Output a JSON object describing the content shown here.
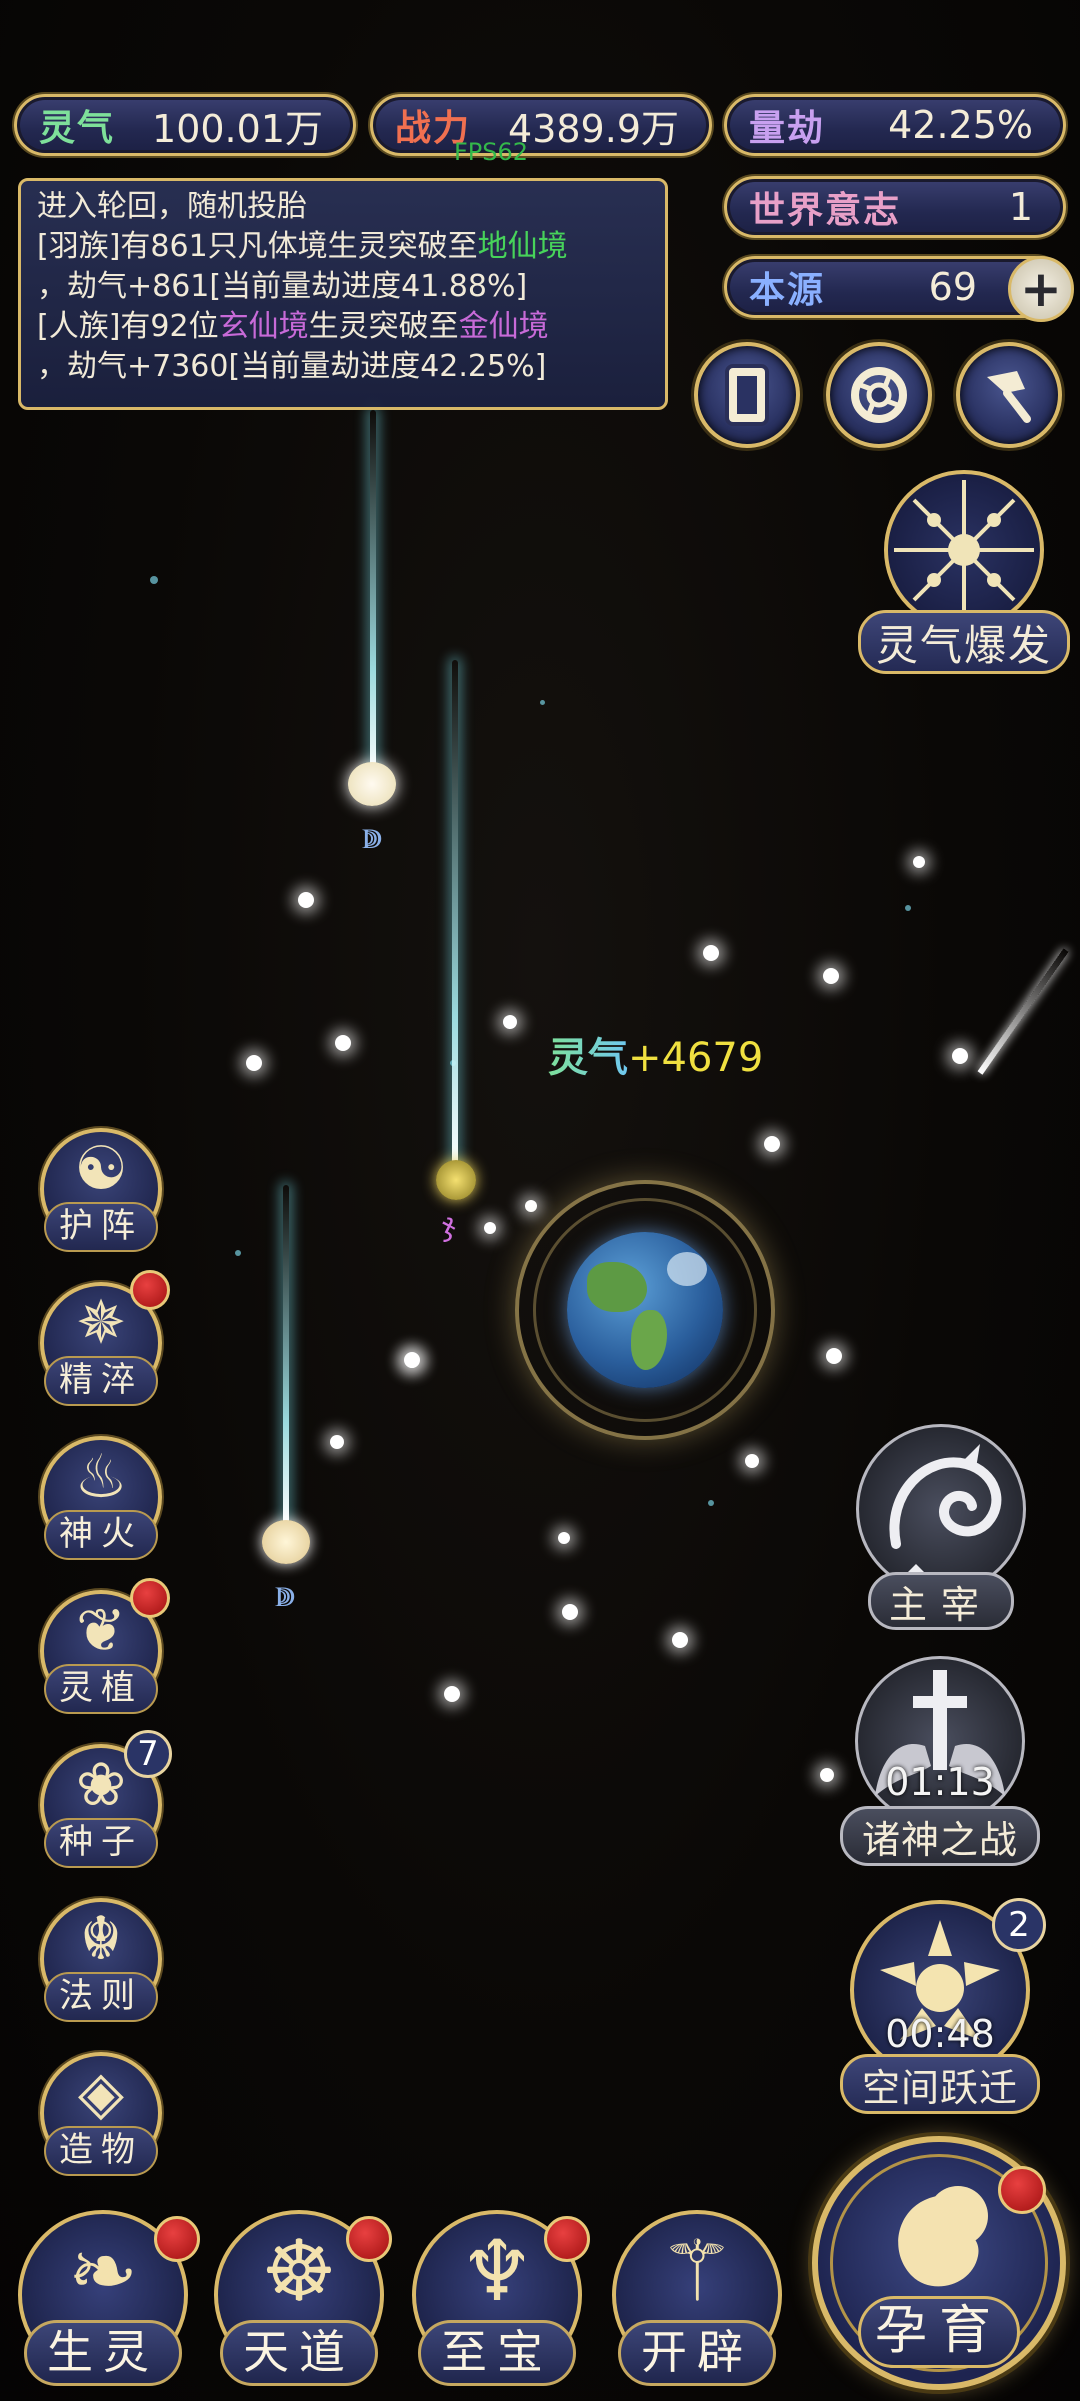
{
  "stats": {
    "lingqi": {
      "label": "灵气",
      "value": "100.01万",
      "color": "#7ee09a"
    },
    "zhanli": {
      "label": "战力",
      "value": "4389.9万",
      "color": "#f07050"
    },
    "liangjie": {
      "label": "量劫",
      "value": "42.25%",
      "color": "#c8a0f0"
    },
    "shijie": {
      "label": "世界意志",
      "value": "1",
      "color": "#e8a0c8"
    },
    "benyuan": {
      "label": "本源",
      "value": "69",
      "color": "#8ab0ff"
    }
  },
  "fps": "FPS62",
  "log": {
    "line1": "进入轮回，随机投胎",
    "line2a": "[羽族]有861只凡体境生灵突破至",
    "line2b": "地仙境",
    "line3": "，劫气+861[当前量劫进度41.88%]",
    "line4a": "[人族]有92位",
    "line4b": "玄仙境",
    "line4c": "生灵突破至",
    "line4d": "金仙境",
    "line5": "，劫气+7360[当前量劫进度42.25%]"
  },
  "floating": {
    "label": "灵气",
    "value": "+4679"
  },
  "top_right_icons": [
    "scroll-icon",
    "vortex-icon",
    "axe-icon"
  ],
  "burst": {
    "label": "灵气爆发"
  },
  "left_menu": [
    {
      "label": "护阵",
      "icon": "yin-yang-icon",
      "glyph": "☯",
      "badge": false
    },
    {
      "label": "精淬",
      "icon": "flame-lotus-icon",
      "glyph": "✵",
      "badge": true
    },
    {
      "label": "神火",
      "icon": "divine-fire-icon",
      "glyph": "♨",
      "badge": false
    },
    {
      "label": "灵植",
      "icon": "spirit-plant-icon",
      "glyph": "❦",
      "badge": true
    },
    {
      "label": "种子",
      "icon": "seed-icon",
      "glyph": "❀",
      "badge": false,
      "count": "7"
    },
    {
      "label": "法则",
      "icon": "law-icon",
      "glyph": "☬",
      "badge": false
    },
    {
      "label": "造物",
      "icon": "creation-icon",
      "glyph": "◈",
      "badge": false
    }
  ],
  "right_menu": {
    "zhuzai": {
      "label": "主宰"
    },
    "zhushen": {
      "label": "诸神之战",
      "timer": "01:13"
    },
    "kongjian": {
      "label": "空间跃迁",
      "timer": "00:48",
      "count": "2"
    }
  },
  "bottom_nav": [
    {
      "label": "生灵",
      "icon": "creature-icon",
      "glyph": "❧",
      "badge": true
    },
    {
      "label": "天道",
      "icon": "heavenly-way-icon",
      "glyph": "☸",
      "badge": true
    },
    {
      "label": "至宝",
      "icon": "treasure-icon",
      "glyph": "♆",
      "badge": true
    },
    {
      "label": "开辟",
      "icon": "creation-split-icon",
      "glyph": "⚚",
      "badge": false
    }
  ],
  "main_action": {
    "label": "孕育",
    "badge": true
  }
}
